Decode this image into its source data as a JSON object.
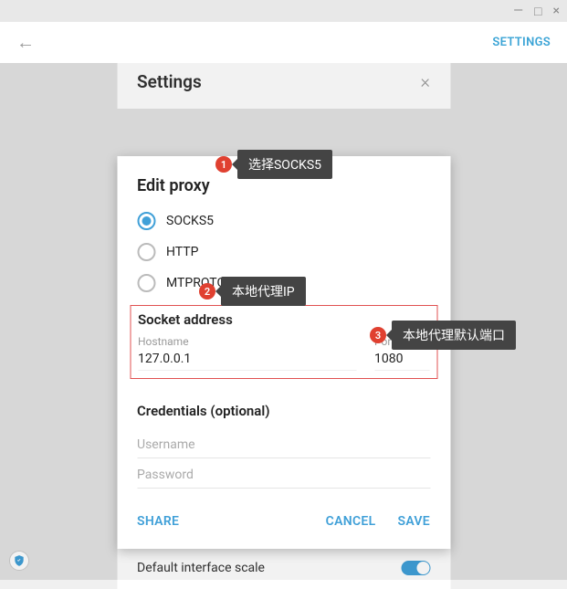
{
  "window": {
    "min": "—",
    "max": "□",
    "close": "×"
  },
  "header": {
    "settings": "SETTINGS"
  },
  "settings_panel": {
    "title": "Settings"
  },
  "dialog": {
    "title": "Edit proxy",
    "radios": {
      "socks5": "SOCKS5",
      "http": "HTTP",
      "mtproto": "MTPROTO"
    },
    "socket_title": "Socket address",
    "hostname_label": "Hostname",
    "hostname_value": "127.0.0.1",
    "port_label": "Port",
    "port_value": "1080",
    "credentials_title": "Credentials (optional)",
    "username_placeholder": "Username",
    "password_placeholder": "Password",
    "share": "SHARE",
    "cancel": "CANCEL",
    "save": "SAVE"
  },
  "bottom": {
    "scale": "Default interface scale"
  },
  "annotations": {
    "n1": "1",
    "t1": "选择SOCKS5",
    "n2": "2",
    "t2": "本地代理IP",
    "n3": "3",
    "t3": "本地代理默认端口"
  }
}
